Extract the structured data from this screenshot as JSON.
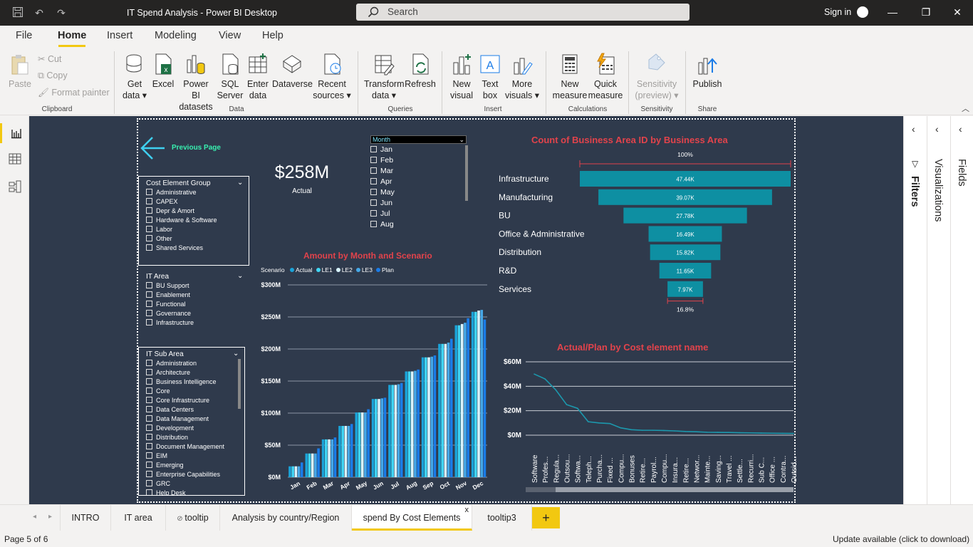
{
  "window": {
    "title": "IT Spend Analysis - Power BI Desktop",
    "search_label": "Search",
    "signin_label": "Sign in"
  },
  "menu": [
    "File",
    "Home",
    "Insert",
    "Modeling",
    "View",
    "Help"
  ],
  "ribbon": {
    "clipboard": {
      "paste": "Paste",
      "cut": "Cut",
      "copy": "Copy",
      "format_painter": "Format painter",
      "group": "Clipboard"
    },
    "data": {
      "get_data": [
        "Get",
        "data"
      ],
      "excel": "Excel",
      "powerbi": [
        "Power BI",
        "datasets"
      ],
      "sql": [
        "SQL",
        "Server"
      ],
      "enter": [
        "Enter",
        "data"
      ],
      "dataverse": "Dataverse",
      "recent": [
        "Recent",
        "sources"
      ],
      "group": "Data"
    },
    "queries": {
      "transform": [
        "Transform",
        "data"
      ],
      "refresh": "Refresh",
      "group": "Queries"
    },
    "insert": {
      "new_visual": [
        "New",
        "visual"
      ],
      "text_box": [
        "Text",
        "box"
      ],
      "more_visuals": [
        "More",
        "visuals"
      ],
      "group": "Insert"
    },
    "calculations": {
      "new_measure": [
        "New",
        "measure"
      ],
      "quick_measure": [
        "Quick",
        "measure"
      ],
      "group": "Calculations"
    },
    "sensitivity": {
      "label": [
        "Sensitivity",
        "(preview)"
      ],
      "group": "Sensitivity"
    },
    "share": {
      "publish": "Publish",
      "group": "Share"
    }
  },
  "report": {
    "prev_page": "Previous Page",
    "kpi": {
      "value": "$258M",
      "label": "Actual"
    },
    "month_slicer": {
      "header": "Month",
      "items": [
        "Jan",
        "Feb",
        "Mar",
        "Apr",
        "May",
        "Jun",
        "Jul",
        "Aug"
      ]
    },
    "cost_element_slicer": {
      "header": "Cost Element Group",
      "items": [
        "Administrative",
        "CAPEX",
        "Depr & Amort",
        "Hardware & Software",
        "Labor",
        "Other",
        "Shared Services"
      ]
    },
    "it_area_slicer": {
      "header": "IT Area",
      "items": [
        "BU Support",
        "Enablement",
        "Functional",
        "Governance",
        "Infrastructure"
      ]
    },
    "it_sub_area_slicer": {
      "header": "IT Sub Area",
      "items": [
        "Administration",
        "Architecture",
        "Business Intelligence",
        "Core",
        "Core Infrastructure",
        "Data Centers",
        "Data Management",
        "Development",
        "Distribution",
        "Document Management",
        "EIM",
        "Emerging",
        "Enterprise Capabilities",
        "GRC",
        "Help Desk"
      ]
    }
  },
  "chart_data": [
    {
      "type": "bar",
      "title": "Amount by Month and Scenario",
      "legend_title": "Scenario",
      "categories": [
        "Jan",
        "Feb",
        "Mar",
        "Apr",
        "May",
        "Jun",
        "Jul",
        "Aug",
        "Sep",
        "Oct",
        "Nov",
        "Dec"
      ],
      "series": [
        {
          "name": "Actual",
          "color": "#1aa3d9",
          "values": [
            17,
            37,
            59,
            80,
            101,
            122,
            144,
            165,
            187,
            208,
            237,
            258
          ]
        },
        {
          "name": "LE1",
          "color": "#41d6f5",
          "values": [
            17,
            37,
            59,
            80,
            101,
            122,
            144,
            165,
            187,
            208,
            237,
            258
          ]
        },
        {
          "name": "LE2",
          "color": "#d9f4ff",
          "values": [
            17,
            37,
            59,
            80,
            101,
            122,
            144,
            165,
            187,
            208,
            239,
            260
          ]
        },
        {
          "name": "LE3",
          "color": "#46a8e8",
          "values": [
            17,
            37,
            59,
            80,
            101,
            123,
            145,
            166,
            188,
            210,
            241,
            261
          ]
        },
        {
          "name": "Plan",
          "color": "#1a7ce8",
          "values": [
            23,
            45,
            62,
            83,
            106,
            124,
            147,
            168,
            190,
            216,
            248,
            246
          ]
        }
      ],
      "y_ticks": [
        "$0M",
        "$50M",
        "$100M",
        "$150M",
        "$200M",
        "$250M",
        "$300M"
      ],
      "ylim": [
        0,
        300
      ]
    },
    {
      "type": "bar",
      "subtype": "funnel",
      "title": "Count of Business Area ID by Business Area",
      "categories": [
        "Infrastructure",
        "Manufacturing",
        "BU",
        "Office & Administrative",
        "Distribution",
        "R&D",
        "Services"
      ],
      "values": [
        47.44,
        39.07,
        27.78,
        16.49,
        15.82,
        11.65,
        7.97
      ],
      "value_labels": [
        "47.44K",
        "39.07K",
        "27.78K",
        "16.49K",
        "15.82K",
        "11.65K",
        "7.97K"
      ],
      "top_label": "100%",
      "bottom_label": "16.8%"
    },
    {
      "type": "line",
      "title": "Actual/Plan by Cost element name",
      "categories": [
        "Software",
        "Profes...",
        "Regula...",
        "Outsou...",
        "Softwa...",
        "Teleph...",
        "Purcha...",
        "Fixed ...",
        "Compu...",
        "Bonuses",
        "Retire...",
        "Payrol...",
        "Compu...",
        "Insura...",
        "Retire...",
        "Networ...",
        "Mainte...",
        "Saving...",
        "Travel ...",
        "Settle...",
        "Recurri...",
        "Sub C...",
        "Office ...",
        "Contra...",
        "Outsid..."
      ],
      "values": [
        50,
        46,
        37,
        25,
        22,
        11,
        10,
        9.5,
        6,
        4.5,
        4,
        4,
        3.8,
        3.5,
        3,
        2.8,
        2.4,
        2.3,
        2.2,
        2,
        1.9,
        1.7,
        1.6,
        1.5,
        1.4
      ],
      "y_ticks": [
        "$0M",
        "$20M",
        "$40M",
        "$60M"
      ],
      "ylim": [
        0,
        60
      ]
    }
  ],
  "filters_label": "Filters",
  "visualizations_label": "Visualizations",
  "fields_label": "Fields",
  "tabs": [
    "INTRO",
    "IT area",
    "tooltip",
    "Analysis by country/Region",
    "spend By Cost Elements",
    "tooltip3"
  ],
  "status": {
    "page": "Page 5 of 6",
    "update": "Update available (click to download)"
  }
}
